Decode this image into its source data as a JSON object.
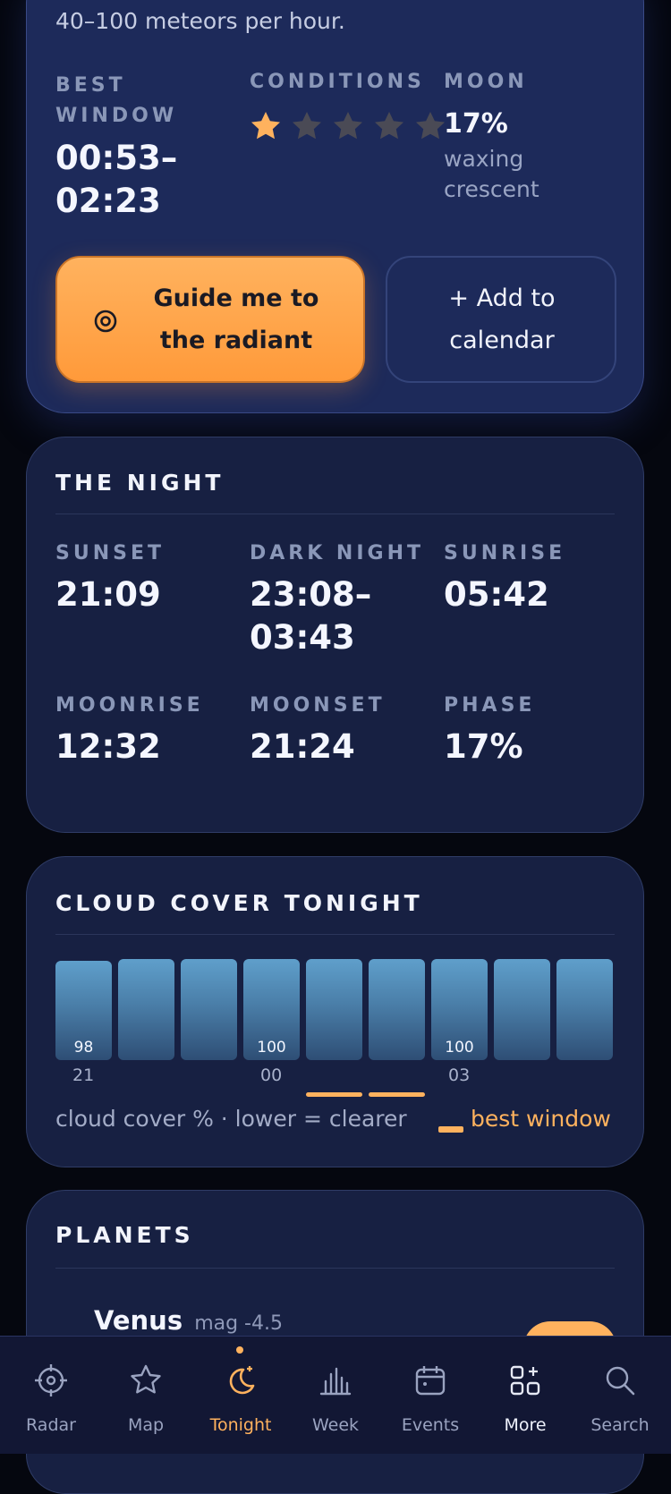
{
  "hero": {
    "rate_text": "40–100 meteors per hour.",
    "best_window_label": "BEST WINDOW",
    "best_window_value": "00:53–\n02:23",
    "conditions_label": "CONDITIONS",
    "conditions_rating": 1,
    "conditions_max": 5,
    "moon_label": "MOON",
    "moon_percent": "17%",
    "moon_phase": "waxing crescent",
    "guide_button": "Guide me to the radiant",
    "calendar_button": "+ Add to calendar",
    "colors": {
      "accent": "#ffb25e",
      "star_off": "#4a4a55"
    }
  },
  "night": {
    "title": "THE NIGHT",
    "items": [
      {
        "label": "SUNSET",
        "value": "21:09"
      },
      {
        "label": "DARK NIGHT",
        "value": "23:08–\n03:43"
      },
      {
        "label": "SUNRISE",
        "value": "05:42"
      },
      {
        "label": "MOONRISE",
        "value": "12:32"
      },
      {
        "label": "MOONSET",
        "value": "21:24"
      },
      {
        "label": "PHASE",
        "value": "17%"
      }
    ]
  },
  "cloud": {
    "title": "CLOUD COVER TONIGHT",
    "legend_text": "cloud cover % · lower = clearer",
    "legend_best": "best window"
  },
  "chart_data": {
    "type": "bar",
    "title": "CLOUD COVER TONIGHT",
    "categories": [
      "21",
      "22",
      "23",
      "00",
      "01",
      "02",
      "03",
      "04",
      "05"
    ],
    "tick_labels_shown": [
      "21",
      "00",
      "03"
    ],
    "values": [
      98,
      100,
      100,
      100,
      100,
      100,
      100,
      100,
      100
    ],
    "value_labels_shown": [
      "98",
      "100",
      "100"
    ],
    "best_window_bars": [
      4,
      5
    ],
    "ylim": [
      0,
      100
    ]
  },
  "planets": {
    "title": "PLANETS",
    "first_name": "Venus",
    "first_mag": "mag -4.5"
  },
  "nav": {
    "items": [
      {
        "label": "Radar",
        "icon": "radar-icon"
      },
      {
        "label": "Map",
        "icon": "star-icon"
      },
      {
        "label": "Tonight",
        "icon": "moon-icon"
      },
      {
        "label": "Week",
        "icon": "bar-chart-icon"
      },
      {
        "label": "Events",
        "icon": "calendar-icon"
      },
      {
        "label": "More",
        "icon": "grid-icon"
      },
      {
        "label": "Search",
        "icon": "search-icon"
      }
    ],
    "active": "Tonight"
  }
}
